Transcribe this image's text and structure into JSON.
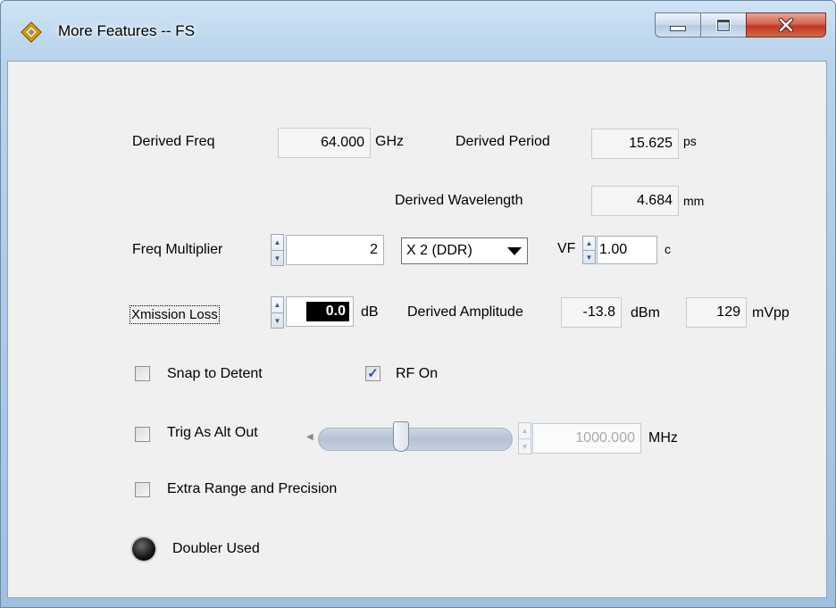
{
  "window": {
    "title": "More Features -- FS",
    "minimize_icon": "minimize-icon",
    "maximize_icon": "maximize-icon",
    "close_icon": "close-icon",
    "close_color": "#c7432a"
  },
  "derived_freq": {
    "label": "Derived Freq",
    "value": "64.000",
    "unit": "GHz"
  },
  "derived_period": {
    "label": "Derived Period",
    "value": "15.625",
    "unit": "ps"
  },
  "derived_wavelength": {
    "label": "Derived Wavelength",
    "value": "4.684",
    "unit": "mm"
  },
  "freq_multiplier": {
    "label": "Freq Multiplier",
    "value": "2",
    "mode_selected": "X 2 (DDR)"
  },
  "vf": {
    "label": "VF",
    "value": "1.00",
    "unit": "c"
  },
  "xmission_loss": {
    "label": "Xmission Loss",
    "value": "0.0",
    "unit": "dB"
  },
  "derived_amplitude": {
    "label": "Derived Amplitude",
    "dbm_value": "-13.8",
    "dbm_unit": "dBm",
    "mvpp_value": "129",
    "mvpp_unit": "mVpp"
  },
  "snap_to_detent": {
    "label": "Snap to Detent",
    "checked": false
  },
  "rf_on": {
    "label": "RF On",
    "checked": true
  },
  "trig_as_alt_out": {
    "label": "Trig As Alt Out",
    "checked": false,
    "slider_level": 0.42,
    "value": "1000.000",
    "unit": "MHz"
  },
  "extra_range": {
    "label": "Extra Range and Precision",
    "checked": false
  },
  "doubler": {
    "label": "Doubler Used",
    "indicator_on": false
  }
}
